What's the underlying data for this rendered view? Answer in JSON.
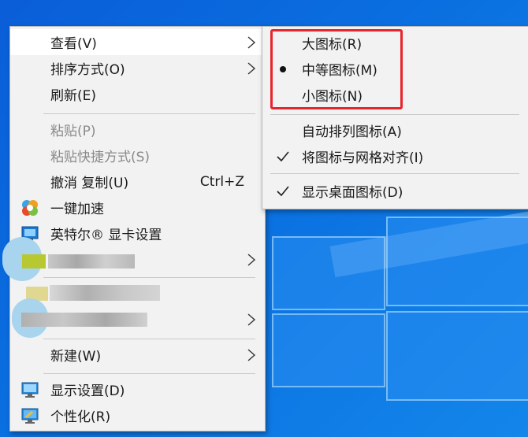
{
  "main_menu": {
    "items": [
      {
        "label": "查看(V)"
      },
      {
        "label": "排序方式(O)"
      },
      {
        "label": "刷新(E)"
      },
      {
        "label": "粘贴(P)"
      },
      {
        "label": "粘贴快捷方式(S)"
      },
      {
        "label": "撤消 复制(U)",
        "shortcut": "Ctrl+Z"
      },
      {
        "label": "一键加速"
      },
      {
        "label": "英特尔® 显卡设置"
      },
      {
        "label": "新建(W)"
      },
      {
        "label": "显示设置(D)"
      },
      {
        "label": "个性化(R)"
      }
    ]
  },
  "sub_menu": {
    "items": [
      {
        "label": "大图标(R)"
      },
      {
        "label": "中等图标(M)"
      },
      {
        "label": "小图标(N)"
      },
      {
        "label": "自动排列图标(A)"
      },
      {
        "label": "将图标与网格对齐(I)"
      },
      {
        "label": "显示桌面图标(D)"
      }
    ]
  },
  "icons": {
    "accelerate": "speedup-ball-icon",
    "intel": "intel-graphics-icon",
    "display": "display-settings-icon",
    "personalize": "personalize-icon",
    "arrow": "chevron-right-icon",
    "bullet": "radio-bullet-icon",
    "check": "checkmark-icon"
  },
  "colors": {
    "menu_bg": "#f2f2f2",
    "highlight_box": "#e8242c",
    "desktop": "#0a6fe0"
  }
}
